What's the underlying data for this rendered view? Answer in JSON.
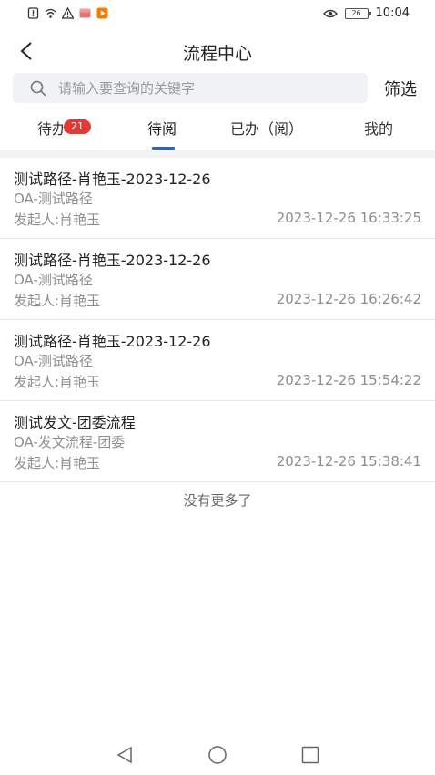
{
  "status_bar": {
    "time": "10:04",
    "battery": "26"
  },
  "header": {
    "title": "流程中心"
  },
  "search": {
    "placeholder": "请输入要查询的关键字",
    "value": "",
    "filter_label": "筛选"
  },
  "tabs": [
    {
      "label": "待办",
      "badge": "21"
    },
    {
      "label": "待阅",
      "active": true
    },
    {
      "label": "已办（阅）"
    },
    {
      "label": "我的"
    }
  ],
  "items": [
    {
      "title": "测试路径-肖艳玉-2023-12-26",
      "subtitle": "OA-测试路径",
      "starter": "发起人:肖艳玉",
      "time": "2023-12-26 16:33:25"
    },
    {
      "title": "测试路径-肖艳玉-2023-12-26",
      "subtitle": "OA-测试路径",
      "starter": "发起人:肖艳玉",
      "time": "2023-12-26 16:26:42"
    },
    {
      "title": "测试路径-肖艳玉-2023-12-26",
      "subtitle": "OA-测试路径",
      "starter": "发起人:肖艳玉",
      "time": "2023-12-26 15:54:22"
    },
    {
      "title": "测试发文-团委流程",
      "subtitle": "OA-发文流程-团委",
      "starter": "发起人:肖艳玉",
      "time": "2023-12-26 15:38:41"
    }
  ],
  "footer": {
    "no_more": "没有更多了"
  },
  "colors": {
    "accent": "#2366c8",
    "badge": "#e53935"
  }
}
